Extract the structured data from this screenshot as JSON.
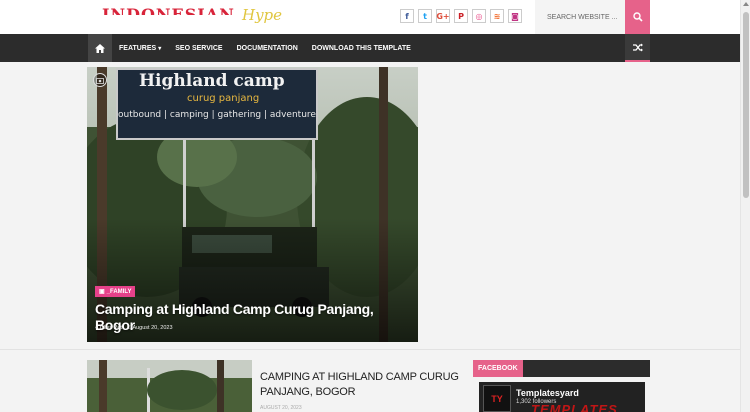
{
  "logo": {
    "main": "INDONESIAN",
    "sub": "Hype"
  },
  "social": [
    {
      "icon": "facebook-icon",
      "glyph": "f",
      "color": "#3b5998"
    },
    {
      "icon": "twitter-icon",
      "glyph": "t",
      "color": "#1da1f2"
    },
    {
      "icon": "google-plus-icon",
      "glyph": "G+",
      "color": "#dd4b39"
    },
    {
      "icon": "pinterest-icon",
      "glyph": "P",
      "color": "#cb2027"
    },
    {
      "icon": "dribbble-icon",
      "glyph": "◎",
      "color": "#ea4c89"
    },
    {
      "icon": "rss-icon",
      "glyph": "≋",
      "color": "#f26522"
    },
    {
      "icon": "instagram-icon",
      "glyph": "◙",
      "color": "#c13584"
    }
  ],
  "search": {
    "placeholder": "SEARCH WEBSITE ..."
  },
  "nav": {
    "items": [
      {
        "label": "FEATURES",
        "dropdown": true
      },
      {
        "label": "SEO SERVICE",
        "dropdown": false
      },
      {
        "label": "DOCUMENTATION",
        "dropdown": false
      },
      {
        "label": "DOWNLOAD THIS TEMPLATE",
        "dropdown": false
      }
    ]
  },
  "featured": {
    "category": "_FAMILY",
    "title": "Camping at Highland Camp Curug Panjang, Bogor",
    "author": "Clies Pat",
    "date": "August 20, 2023",
    "sign_title": "Highland camp",
    "sign_sub": "curug panjang"
  },
  "post": {
    "title": "CAMPING AT HIGHLAND CAMP CURUG PANJANG, BOGOR",
    "date": "AUGUST 20, 2023"
  },
  "sidebar": {
    "facebook_label": "FACEBOOK",
    "page_name": "Templatesyard",
    "followers": "1,302 followers",
    "banner": "TEMPLATES"
  },
  "colors": {
    "accent": "#e6628a",
    "nav_bg": "#2c2c2c",
    "category": "#e6418a"
  }
}
